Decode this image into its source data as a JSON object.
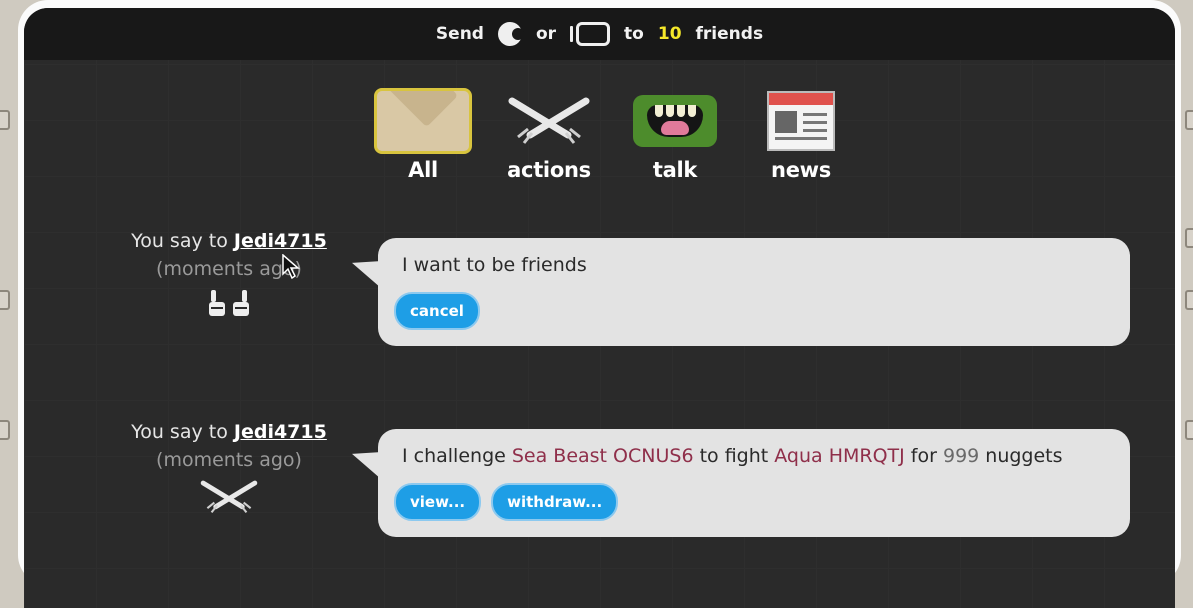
{
  "header": {
    "send": "Send",
    "or": "or",
    "to": "to",
    "count": "10",
    "friends": "friends"
  },
  "tabs": [
    {
      "label": "All",
      "icon": "envelope-icon"
    },
    {
      "label": "actions",
      "icon": "crossed-swords-icon"
    },
    {
      "label": "talk",
      "icon": "mouth-icon"
    },
    {
      "label": "news",
      "icon": "newspaper-icon"
    }
  ],
  "messages": [
    {
      "prefix": "You say to",
      "name": "Jedi4715",
      "time": "(moments ago)",
      "icon": "hands-icon",
      "text": "I want to be friends",
      "buttons": [
        "cancel"
      ]
    },
    {
      "prefix": "You say to",
      "name": "Jedi4715",
      "time": "(moments ago)",
      "icon": "crossed-swords-icon",
      "text_parts": [
        "I challenge ",
        "Sea Beast OCNUS6",
        " to fight ",
        "Aqua HMRQTJ",
        " for ",
        "999",
        " nuggets"
      ],
      "buttons": [
        "view...",
        "withdraw..."
      ]
    }
  ],
  "colors": {
    "accent_yellow": "#f5e82a",
    "button_blue": "#1e9ee6",
    "highlight": "#8f2f4a"
  }
}
